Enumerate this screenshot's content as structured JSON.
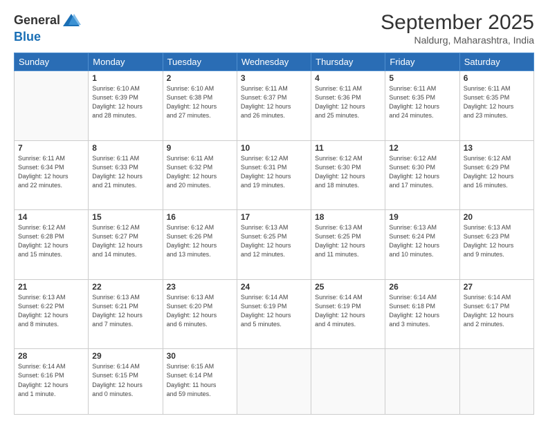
{
  "header": {
    "logo_general": "General",
    "logo_blue": "Blue",
    "month": "September 2025",
    "location": "Naldurg, Maharashtra, India"
  },
  "days_of_week": [
    "Sunday",
    "Monday",
    "Tuesday",
    "Wednesday",
    "Thursday",
    "Friday",
    "Saturday"
  ],
  "weeks": [
    [
      {
        "day": "",
        "info": ""
      },
      {
        "day": "1",
        "info": "Sunrise: 6:10 AM\nSunset: 6:39 PM\nDaylight: 12 hours\nand 28 minutes."
      },
      {
        "day": "2",
        "info": "Sunrise: 6:10 AM\nSunset: 6:38 PM\nDaylight: 12 hours\nand 27 minutes."
      },
      {
        "day": "3",
        "info": "Sunrise: 6:11 AM\nSunset: 6:37 PM\nDaylight: 12 hours\nand 26 minutes."
      },
      {
        "day": "4",
        "info": "Sunrise: 6:11 AM\nSunset: 6:36 PM\nDaylight: 12 hours\nand 25 minutes."
      },
      {
        "day": "5",
        "info": "Sunrise: 6:11 AM\nSunset: 6:35 PM\nDaylight: 12 hours\nand 24 minutes."
      },
      {
        "day": "6",
        "info": "Sunrise: 6:11 AM\nSunset: 6:35 PM\nDaylight: 12 hours\nand 23 minutes."
      }
    ],
    [
      {
        "day": "7",
        "info": "Sunrise: 6:11 AM\nSunset: 6:34 PM\nDaylight: 12 hours\nand 22 minutes."
      },
      {
        "day": "8",
        "info": "Sunrise: 6:11 AM\nSunset: 6:33 PM\nDaylight: 12 hours\nand 21 minutes."
      },
      {
        "day": "9",
        "info": "Sunrise: 6:11 AM\nSunset: 6:32 PM\nDaylight: 12 hours\nand 20 minutes."
      },
      {
        "day": "10",
        "info": "Sunrise: 6:12 AM\nSunset: 6:31 PM\nDaylight: 12 hours\nand 19 minutes."
      },
      {
        "day": "11",
        "info": "Sunrise: 6:12 AM\nSunset: 6:30 PM\nDaylight: 12 hours\nand 18 minutes."
      },
      {
        "day": "12",
        "info": "Sunrise: 6:12 AM\nSunset: 6:30 PM\nDaylight: 12 hours\nand 17 minutes."
      },
      {
        "day": "13",
        "info": "Sunrise: 6:12 AM\nSunset: 6:29 PM\nDaylight: 12 hours\nand 16 minutes."
      }
    ],
    [
      {
        "day": "14",
        "info": "Sunrise: 6:12 AM\nSunset: 6:28 PM\nDaylight: 12 hours\nand 15 minutes."
      },
      {
        "day": "15",
        "info": "Sunrise: 6:12 AM\nSunset: 6:27 PM\nDaylight: 12 hours\nand 14 minutes."
      },
      {
        "day": "16",
        "info": "Sunrise: 6:12 AM\nSunset: 6:26 PM\nDaylight: 12 hours\nand 13 minutes."
      },
      {
        "day": "17",
        "info": "Sunrise: 6:13 AM\nSunset: 6:25 PM\nDaylight: 12 hours\nand 12 minutes."
      },
      {
        "day": "18",
        "info": "Sunrise: 6:13 AM\nSunset: 6:25 PM\nDaylight: 12 hours\nand 11 minutes."
      },
      {
        "day": "19",
        "info": "Sunrise: 6:13 AM\nSunset: 6:24 PM\nDaylight: 12 hours\nand 10 minutes."
      },
      {
        "day": "20",
        "info": "Sunrise: 6:13 AM\nSunset: 6:23 PM\nDaylight: 12 hours\nand 9 minutes."
      }
    ],
    [
      {
        "day": "21",
        "info": "Sunrise: 6:13 AM\nSunset: 6:22 PM\nDaylight: 12 hours\nand 8 minutes."
      },
      {
        "day": "22",
        "info": "Sunrise: 6:13 AM\nSunset: 6:21 PM\nDaylight: 12 hours\nand 7 minutes."
      },
      {
        "day": "23",
        "info": "Sunrise: 6:13 AM\nSunset: 6:20 PM\nDaylight: 12 hours\nand 6 minutes."
      },
      {
        "day": "24",
        "info": "Sunrise: 6:14 AM\nSunset: 6:19 PM\nDaylight: 12 hours\nand 5 minutes."
      },
      {
        "day": "25",
        "info": "Sunrise: 6:14 AM\nSunset: 6:19 PM\nDaylight: 12 hours\nand 4 minutes."
      },
      {
        "day": "26",
        "info": "Sunrise: 6:14 AM\nSunset: 6:18 PM\nDaylight: 12 hours\nand 3 minutes."
      },
      {
        "day": "27",
        "info": "Sunrise: 6:14 AM\nSunset: 6:17 PM\nDaylight: 12 hours\nand 2 minutes."
      }
    ],
    [
      {
        "day": "28",
        "info": "Sunrise: 6:14 AM\nSunset: 6:16 PM\nDaylight: 12 hours\nand 1 minute."
      },
      {
        "day": "29",
        "info": "Sunrise: 6:14 AM\nSunset: 6:15 PM\nDaylight: 12 hours\nand 0 minutes."
      },
      {
        "day": "30",
        "info": "Sunrise: 6:15 AM\nSunset: 6:14 PM\nDaylight: 11 hours\nand 59 minutes."
      },
      {
        "day": "",
        "info": ""
      },
      {
        "day": "",
        "info": ""
      },
      {
        "day": "",
        "info": ""
      },
      {
        "day": "",
        "info": ""
      }
    ]
  ]
}
